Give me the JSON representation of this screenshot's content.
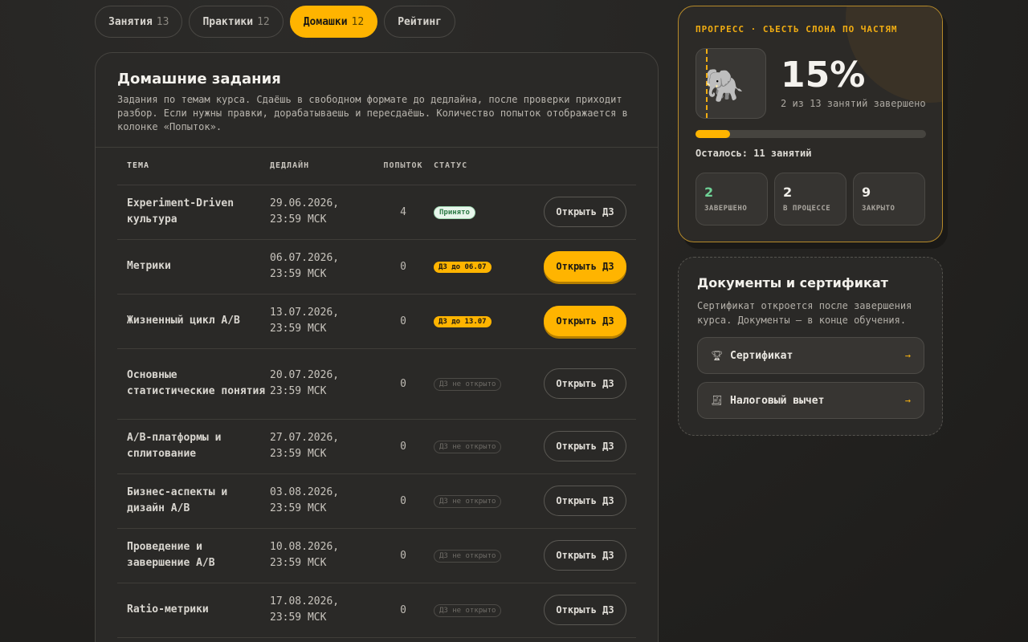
{
  "tabs": [
    {
      "label": "Занятия",
      "count": "13"
    },
    {
      "label": "Практики",
      "count": "12"
    },
    {
      "label": "Домашки",
      "count": "12"
    },
    {
      "label": "Рейтинг",
      "count": ""
    }
  ],
  "homework": {
    "title": "Домашние задания",
    "description": "Задания по темам курса. Сдаёшь в свободном формате до дедлайна, после проверки приходит разбор. Если нужны правки, дорабатываешь и пересдаёшь. Количество попыток отображается в колонке «Попыток».",
    "columns": {
      "topic": "ТЕМА",
      "deadline": "ДЕДЛАЙН",
      "attempts": "ПОПЫТОК",
      "status": "СТАТУС"
    },
    "rows": [
      {
        "topic": "Experiment-Driven культура",
        "deadline": "29.06.2026, 23:59 МСК",
        "attempts": "4",
        "status": "Принято",
        "status_type": "accepted",
        "action": "Открыть ДЗ",
        "primary": false
      },
      {
        "topic": "Метрики",
        "deadline": "06.07.2026, 23:59 МСК",
        "attempts": "0",
        "status": "ДЗ до 06.07",
        "status_type": "due",
        "action": "Открыть ДЗ",
        "primary": true
      },
      {
        "topic": "Жизненный цикл A/B",
        "deadline": "13.07.2026, 23:59 МСК",
        "attempts": "0",
        "status": "ДЗ до 13.07",
        "status_type": "due",
        "action": "Открыть ДЗ",
        "primary": true
      },
      {
        "topic": "Основные статистические понятия",
        "deadline": "20.07.2026, 23:59 МСК",
        "attempts": "0",
        "status": "ДЗ не открыто",
        "status_type": "closed",
        "action": "Открыть ДЗ",
        "primary": false
      },
      {
        "topic": "A/B-платформы и сплитование",
        "deadline": "27.07.2026, 23:59 МСК",
        "attempts": "0",
        "status": "ДЗ не открыто",
        "status_type": "closed",
        "action": "Открыть ДЗ",
        "primary": false
      },
      {
        "topic": "Бизнес-аспекты и дизайн A/B",
        "deadline": "03.08.2026, 23:59 МСК",
        "attempts": "0",
        "status": "ДЗ не открыто",
        "status_type": "closed",
        "action": "Открыть ДЗ",
        "primary": false
      },
      {
        "topic": "Проведение и завершение A/B",
        "deadline": "10.08.2026, 23:59 МСК",
        "attempts": "0",
        "status": "ДЗ не открыто",
        "status_type": "closed",
        "action": "Открыть ДЗ",
        "primary": false
      },
      {
        "topic": "Ratio-метрики",
        "deadline": "17.08.2026, 23:59 МСК",
        "attempts": "0",
        "status": "ДЗ не открыто",
        "status_type": "closed",
        "action": "Открыть ДЗ",
        "primary": false
      }
    ]
  },
  "progress": {
    "label": "ПРОГРЕСС · СЪЕСТЬ СЛОНА ПО ЧАСТЯМ",
    "percent_text": "15%",
    "fraction": 0.15,
    "subtitle": "2 из 13 занятий завершено",
    "remaining": "Осталось: 11 занятий",
    "icon": "elephant-icon",
    "stats": [
      {
        "value": "2",
        "label": "ЗАВЕРШЕНО"
      },
      {
        "value": "2",
        "label": "В ПРОЦЕССЕ"
      },
      {
        "value": "9",
        "label": "ЗАКРЫТО"
      }
    ]
  },
  "documents": {
    "title": "Документы и сертификат",
    "description": "Сертификат откроется после завершения курса. Документы — в конце обучения.",
    "items": [
      {
        "label": "Сертификат",
        "icon": "trophy-icon"
      },
      {
        "label": "Налоговый вычет",
        "icon": "receipt-icon"
      }
    ]
  },
  "colors": {
    "accent": "#ffb400",
    "success": "#6fd196",
    "background": "#242321"
  }
}
